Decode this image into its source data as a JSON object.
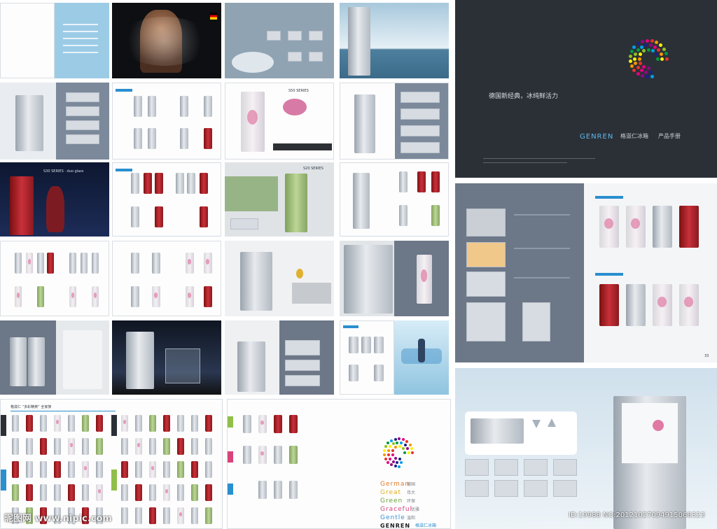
{
  "cover": {
    "slogan": "德国新经典，冰纯鲜活力",
    "brand": "GENREN",
    "brand_cn": "格滋仁冰箱",
    "doc_type": "产品手册"
  },
  "series": {
    "s30": "S30 SERIES · duo glass",
    "s20": "S20 SERIES",
    "s50": "S50 SERIES"
  },
  "catalog_header": "格滋仁 “多彩精英” 全家族",
  "values": {
    "german": "German",
    "german_cn": "德国",
    "great": "Great",
    "great_cn": "伟大",
    "green": "Green",
    "green_cn": "环保",
    "graceful": "Graceful",
    "graceful_cn": "优雅",
    "gentle": "Gentle",
    "gentle_cn": "温和"
  },
  "feature_spread": {
    "page_number": "33"
  },
  "watermark": {
    "site": "昵图网 www.nipic.com",
    "id": "ID:19988 NO:20121027094915068323"
  },
  "colors": {
    "slate": "#6e7b8c",
    "dark": "#2b3037",
    "accent": "#2a8fd0",
    "red": "#c9303a",
    "green": "#bcd696"
  }
}
